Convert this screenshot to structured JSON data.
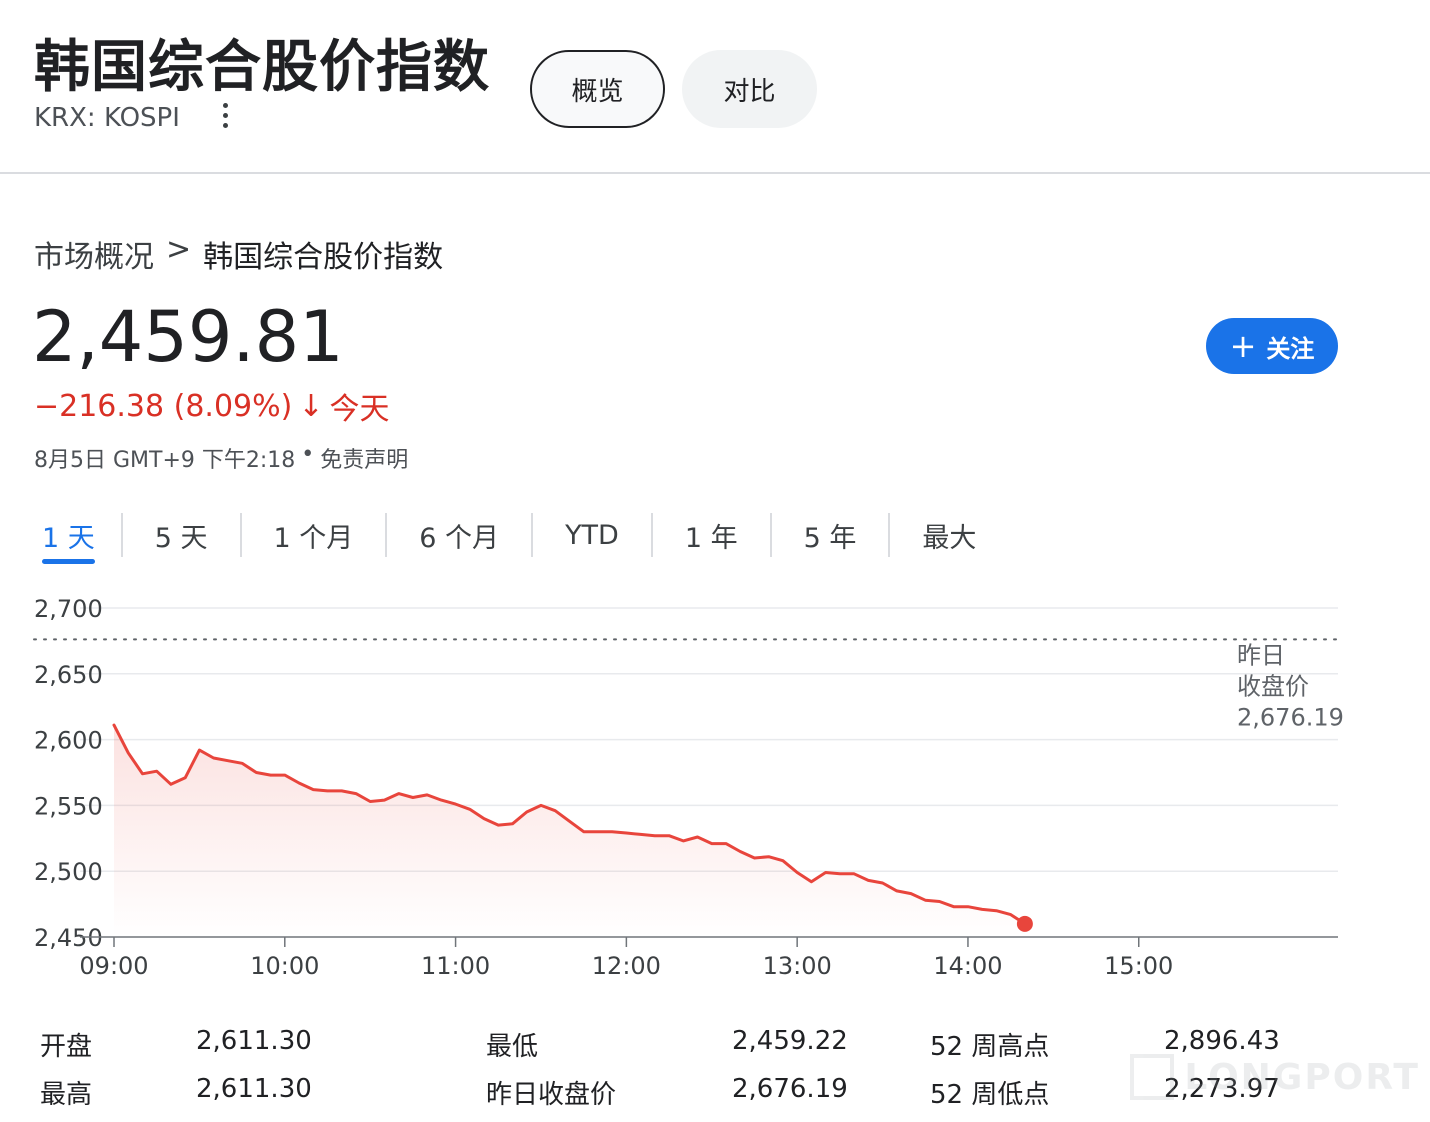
{
  "header": {
    "title": "韩国综合股价指数",
    "ticker": "KRX: KOSPI",
    "tabs": [
      {
        "label": "概览"
      },
      {
        "label": "对比"
      }
    ]
  },
  "breadcrumb": {
    "parent": "市场概况",
    "separator": ">",
    "current": "韩国综合股价指数"
  },
  "quote": {
    "price": "2,459.81",
    "change": "−216.38 (8.09%)",
    "arrow": "↓",
    "period": "今天",
    "timestamp": "8月5日 GMT+9 下午2:18",
    "bullet": "•",
    "disclaimer": "免责声明",
    "follow_plus": "+",
    "follow_label": "关注",
    "change_color": "#d93025"
  },
  "ranges": [
    {
      "label": "1 天",
      "active": true
    },
    {
      "label": "5 天"
    },
    {
      "label": "1 个月"
    },
    {
      "label": "6 个月"
    },
    {
      "label": "YTD"
    },
    {
      "label": "1 年"
    },
    {
      "label": "5 年"
    },
    {
      "label": "最大"
    }
  ],
  "chart_data": {
    "type": "line",
    "ylim": [
      2450,
      2700
    ],
    "yticks": [
      2450,
      2500,
      2550,
      2600,
      2650,
      2700
    ],
    "ytick_labels": [
      "2,450",
      "2,500",
      "2,550",
      "2,600",
      "2,650",
      "2,700"
    ],
    "xlim": [
      "09:00",
      "16:10"
    ],
    "xticks": [
      "09:00",
      "10:00",
      "11:00",
      "12:00",
      "13:00",
      "14:00",
      "15:00"
    ],
    "prev_close": 2676.19,
    "prev_close_label": [
      "昨日",
      "收盘价",
      "2,676.19"
    ],
    "line_color": "#e8453c",
    "x": [
      "09:00",
      "09:05",
      "09:10",
      "09:15",
      "09:20",
      "09:25",
      "09:30",
      "09:35",
      "09:40",
      "09:45",
      "09:50",
      "09:55",
      "10:00",
      "10:05",
      "10:10",
      "10:15",
      "10:20",
      "10:25",
      "10:30",
      "10:35",
      "10:40",
      "10:45",
      "10:50",
      "10:55",
      "11:00",
      "11:05",
      "11:10",
      "11:15",
      "11:20",
      "11:25",
      "11:30",
      "11:35",
      "11:40",
      "11:45",
      "11:50",
      "11:55",
      "12:00",
      "12:05",
      "12:10",
      "12:15",
      "12:20",
      "12:25",
      "12:30",
      "12:35",
      "12:40",
      "12:45",
      "12:50",
      "12:55",
      "13:00",
      "13:05",
      "13:10",
      "13:15",
      "13:20",
      "13:25",
      "13:30",
      "13:35",
      "13:40",
      "13:45",
      "13:50",
      "13:55",
      "14:00",
      "14:05",
      "14:10",
      "14:15",
      "14:20"
    ],
    "y": [
      2611,
      2590,
      2574,
      2576,
      2566,
      2571,
      2592,
      2586,
      2584,
      2582,
      2575,
      2573,
      2573,
      2567,
      2562,
      2561,
      2561,
      2559,
      2553,
      2554,
      2559,
      2556,
      2558,
      2554,
      2551,
      2547,
      2540,
      2535,
      2536,
      2545,
      2550,
      2546,
      2538,
      2530,
      2530,
      2530,
      2529,
      2528,
      2527,
      2527,
      2523,
      2526,
      2521,
      2521,
      2515,
      2510,
      2511,
      2508,
      2499,
      2492,
      2499,
      2498,
      2498,
      2493,
      2491,
      2485,
      2483,
      2478,
      2477,
      2473,
      2473,
      2471,
      2470,
      2467,
      2460
    ]
  },
  "stats": [
    {
      "label": "开盘",
      "value": "2,611.30"
    },
    {
      "label": "最高",
      "value": "2,611.30"
    },
    {
      "label": "最低",
      "value": "2,459.22"
    },
    {
      "label": "昨日收盘价",
      "value": "2,676.19"
    },
    {
      "label": "52 周高点",
      "value": "2,896.43"
    },
    {
      "label": "52 周低点",
      "value": "2,273.97"
    }
  ],
  "watermark": {
    "text": "LONGPORT"
  }
}
